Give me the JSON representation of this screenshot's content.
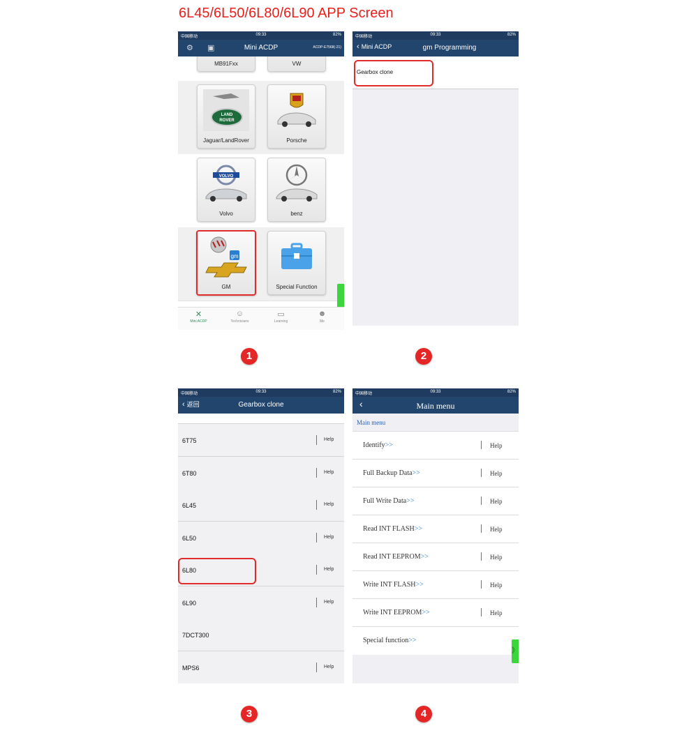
{
  "page_title": "6L45/6L50/6L80/6L90 APP Screen",
  "status_bar": {
    "carrier": "中国移动",
    "time": "09:33",
    "battery": "82%"
  },
  "screen1": {
    "title": "Mini ACDP",
    "serial": "ACDP-E7568(-21)",
    "brands": [
      {
        "name": "MB91Fxx"
      },
      {
        "name": "VW"
      },
      {
        "name": "Jaguar/LandRover"
      },
      {
        "name": "Porsche"
      },
      {
        "name": "Volvo"
      },
      {
        "name": "benz"
      },
      {
        "name": "GM"
      },
      {
        "name": "Special Function"
      }
    ],
    "tabs": [
      {
        "label": "Mini ACDP",
        "icon": "wrench-icon"
      },
      {
        "label": "Technicians",
        "icon": "person-icon"
      },
      {
        "label": "Learning",
        "icon": "book-icon"
      },
      {
        "label": "Me",
        "icon": "profile-icon"
      }
    ]
  },
  "screen2": {
    "back_label": "Mini ACDP",
    "title": "gm Programming",
    "item": "Gearbox clone"
  },
  "screen3": {
    "back_label": "返回",
    "title": "Gearbox clone",
    "help_label": "Help",
    "models": [
      "6T75",
      "6T80",
      "6L45",
      "6L50",
      "6L80",
      "6L90",
      "7DCT300",
      "MPS6"
    ]
  },
  "screen4": {
    "title": "Main menu",
    "breadcrumb": "Main menu",
    "help_label": "Help",
    "arrow": ">>",
    "items": [
      {
        "label": "Identify",
        "help": true
      },
      {
        "label": "Full Backup Data",
        "help": true
      },
      {
        "label": "Full Write Data",
        "help": true
      },
      {
        "label": "Read INT FLASH",
        "help": true
      },
      {
        "label": "Read INT EEPROM",
        "help": true
      },
      {
        "label": "Write INT FLASH",
        "help": true
      },
      {
        "label": "Write INT EEPROM",
        "help": true
      },
      {
        "label": "Special function",
        "help": false
      }
    ]
  },
  "steps": [
    "1",
    "2",
    "3",
    "4"
  ],
  "colors": {
    "navbar": "#22456e",
    "highlight": "#e02b2b",
    "step_badge": "#e42626",
    "accent_green": "#3cd63c",
    "link_blue": "#3a82d8"
  }
}
